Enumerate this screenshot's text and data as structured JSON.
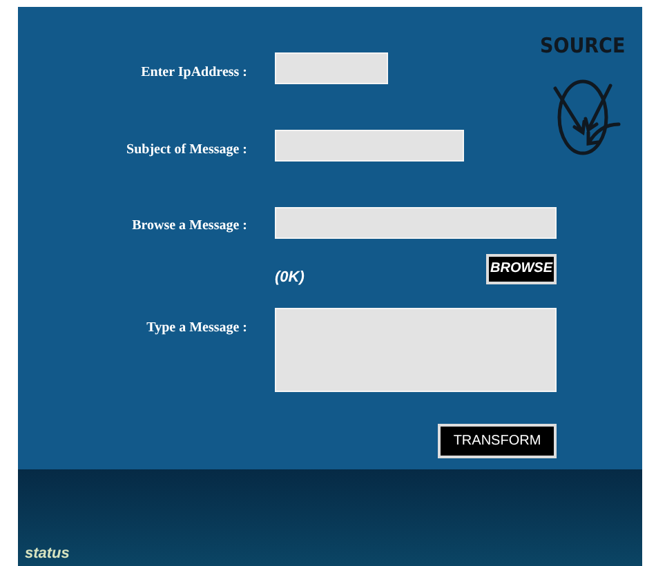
{
  "logo": {
    "text": "SOURCE"
  },
  "fields": [
    {
      "label": "Enter IpAddress :",
      "kind": "short"
    },
    {
      "label": "Subject of Message :",
      "kind": "medium"
    },
    {
      "label": "Browse a Message :",
      "kind": "long"
    },
    {
      "label": "Type a Message :",
      "kind": "area"
    }
  ],
  "file_size": "(0K)",
  "browse_button": "BROWSE",
  "transform_button": "TRANSFORM",
  "status_bar": "status"
}
